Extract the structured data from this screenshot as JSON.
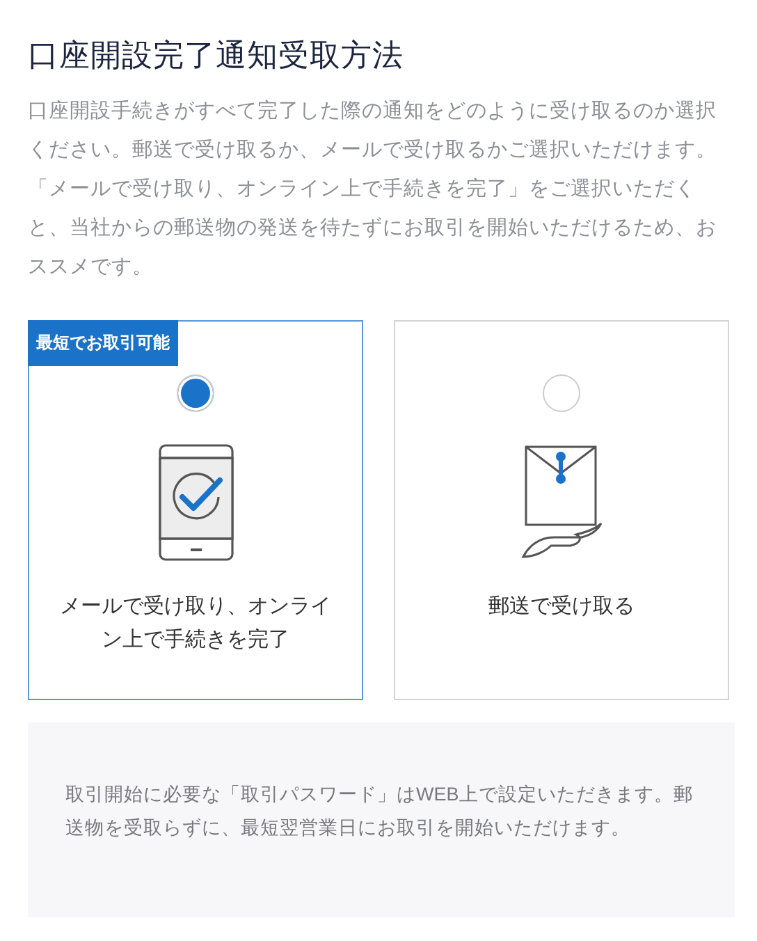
{
  "title": "口座開設完了通知受取方法",
  "description": "口座開設手続きがすべて完了した際の通知をどのように受け取るのか選択ください。郵送で受け取るか、メールで受け取るかご選択いただけます。「メールで受け取り、オンライン上で手続きを完了」をご選択いただくと、当社からの郵送物の発送を待たずにお取引を開始いただけるため、おススメです。",
  "options": [
    {
      "kind": "phone",
      "badge": "最短でお取引可能",
      "label": "メールで受け取り、オンライン上で手続きを完了",
      "selected": true
    },
    {
      "kind": "envelope",
      "label": "郵送で受け取る",
      "selected": false
    }
  ],
  "note": "取引開始に必要な「取引パスワード」はWEB上で設定いただきます。郵送物を受取らずに、最短翌営業日にお取引を開始いただけます。"
}
